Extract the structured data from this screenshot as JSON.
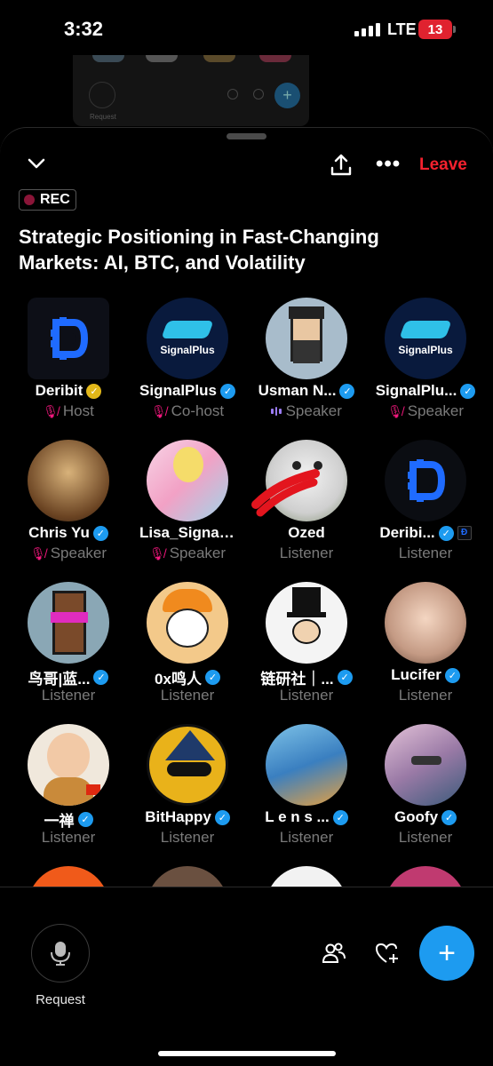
{
  "status_bar": {
    "time": "3:32",
    "network": "LTE",
    "battery": "13"
  },
  "background_sheet": {
    "request_label": "Request"
  },
  "header": {
    "leave_label": "Leave"
  },
  "rec_label": "REC",
  "space_title": "Strategic Positioning in Fast-Changing Markets: AI, BTC, and Volatility",
  "participants": [
    {
      "name": "Deribit",
      "role": "Host",
      "verified": "gold",
      "role_icon": "mic-off-icon"
    },
    {
      "name": "SignalPlus",
      "role": "Co-host",
      "verified": "blue",
      "role_icon": "mic-off-icon",
      "avatar_text": "SignalPlus"
    },
    {
      "name": "Usman N...",
      "role": "Speaker",
      "verified": "blue",
      "role_icon": "speaking-icon"
    },
    {
      "name": "SignalPlu...",
      "role": "Speaker",
      "verified": "blue",
      "role_icon": "mic-off-icon",
      "avatar_text": "SignalPlus"
    },
    {
      "name": "Chris Yu",
      "role": "Speaker",
      "verified": "blue",
      "role_icon": "mic-off-icon"
    },
    {
      "name": "Lisa_Signal...",
      "role": "Speaker",
      "verified": "none",
      "role_icon": "mic-off-icon"
    },
    {
      "name": "Ozed",
      "role": "Listener",
      "verified": "none"
    },
    {
      "name": "Deribi...",
      "role": "Listener",
      "verified": "blue"
    },
    {
      "name": "鸟哥|蓝...",
      "role": "Listener",
      "verified": "blue"
    },
    {
      "name": "0x鸣人",
      "role": "Listener",
      "verified": "blue"
    },
    {
      "name": "链研社｜...",
      "role": "Listener",
      "verified": "blue"
    },
    {
      "name": "Lucifer",
      "role": "Listener",
      "verified": "blue"
    },
    {
      "name": "一禅",
      "role": "Listener",
      "verified": "blue"
    },
    {
      "name": "BitHappy",
      "role": "Listener",
      "verified": "blue"
    },
    {
      "name": "L e n s ...",
      "role": "Listener",
      "verified": "blue"
    },
    {
      "name": "Goofy",
      "role": "Listener",
      "verified": "blue"
    }
  ],
  "bottom_bar": {
    "request_label": "Request"
  },
  "colors": {
    "accent": "#1d9bf0",
    "leave": "#f4212e",
    "muted": "#f91880",
    "role_text": "#7a7a7a"
  }
}
